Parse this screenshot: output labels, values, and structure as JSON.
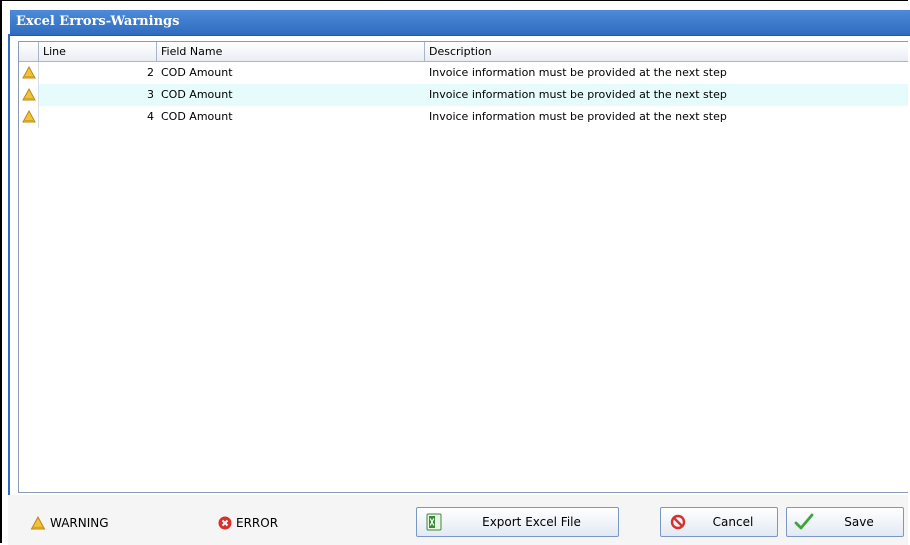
{
  "window": {
    "title": "Excel Errors-Warnings"
  },
  "grid": {
    "columns": [
      "Line",
      "Field Name",
      "Description"
    ],
    "rows": [
      {
        "icon": "warning-icon",
        "line": "2",
        "field": "COD Amount",
        "description": "Invoice information must be provided at the next step"
      },
      {
        "icon": "warning-icon",
        "line": "3",
        "field": "COD Amount",
        "description": "Invoice information must be provided at the next step"
      },
      {
        "icon": "warning-icon",
        "line": "4",
        "field": "COD Amount",
        "description": "Invoice information must be provided at the next step"
      }
    ]
  },
  "legend": {
    "warning_label": "WARNING",
    "error_label": "ERROR"
  },
  "buttons": {
    "export_label": "Export Excel File",
    "cancel_label": "Cancel",
    "save_label": "Save"
  },
  "colors": {
    "title_bar": "#3b78cc",
    "alt_row": "#e6fbfb",
    "warning": "#f2c23a",
    "error": "#d9302c",
    "save_check": "#3aa63a"
  }
}
